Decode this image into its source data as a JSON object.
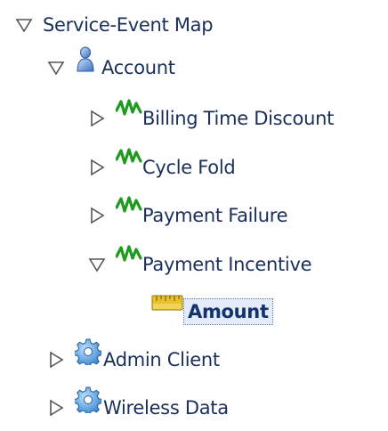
{
  "tree": {
    "root": {
      "label": "Service-Event Map",
      "expanded": true,
      "toggle_icon": "triangle-down-icon"
    },
    "account": {
      "label": "Account",
      "expanded": true,
      "icon": "person-icon",
      "children": [
        {
          "label": "Billing Time Discount",
          "expanded": false,
          "icon": "event-wave-icon"
        },
        {
          "label": "Cycle Fold",
          "expanded": false,
          "icon": "event-wave-icon"
        },
        {
          "label": "Payment Failure",
          "expanded": false,
          "icon": "event-wave-icon"
        },
        {
          "label": "Payment Incentive",
          "expanded": true,
          "icon": "event-wave-icon"
        }
      ]
    },
    "amount": {
      "label": "Amount",
      "selected": true,
      "icon": "ruler-icon"
    },
    "admin_client": {
      "label": "Admin Client",
      "expanded": false,
      "icon": "gear-icon"
    },
    "wireless_data": {
      "label": "Wireless Data",
      "expanded": false,
      "icon": "gear-icon"
    }
  },
  "colors": {
    "text": "#1a2f5a",
    "selected_text": "#12336e",
    "event_icon": "#1e9a1e",
    "gear_icon": "#2f7fc9",
    "ruler_icon": "#e8c12a",
    "person_icon": "#3a6fc0"
  }
}
